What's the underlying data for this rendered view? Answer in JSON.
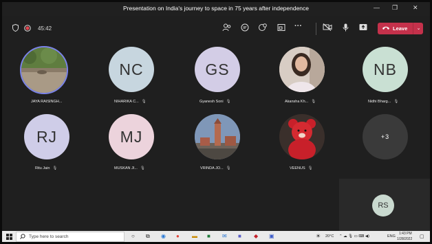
{
  "window": {
    "title": "Presentation on India's journey to space in 75 years after independence",
    "minimize_glyph": "—",
    "maximize_glyph": "❐",
    "close_glyph": "✕"
  },
  "toolbar": {
    "timer": "45:42",
    "leave_label": "Leave",
    "icons": [
      "shield-icon",
      "record-icon",
      "people-icon",
      "chat-icon",
      "reactions-icon",
      "rooms-icon",
      "more-icon",
      "camera-off-icon",
      "mic-icon",
      "share-icon",
      "phone-icon"
    ]
  },
  "participants": [
    {
      "name": "JAYA RAISINGH...",
      "initials": "",
      "type": "photo-wall",
      "speaking": true
    },
    {
      "name": "NIHARIKA C...",
      "initials": "NC",
      "color": "#c7d6df"
    },
    {
      "name": "Gyanesh Soni",
      "initials": "GS",
      "color": "#d3cde6"
    },
    {
      "name": "Akansha Kh...",
      "initials": "",
      "type": "photo-person"
    },
    {
      "name": "Nidhi Bharg...",
      "initials": "NB",
      "color": "#c9e0d3"
    },
    {
      "name": "Ritu Jain",
      "initials": "RJ",
      "color": "#cfcde8"
    },
    {
      "name": "MUSKAN JI...",
      "initials": "MJ",
      "color": "#ecd3dc"
    },
    {
      "name": "VRINDA JO...",
      "initials": "",
      "type": "photo-tower"
    },
    {
      "name": "VEENUS",
      "initials": "",
      "type": "photo-teddy"
    },
    {
      "name": "",
      "initials": "+3",
      "color": "#3a3a3a",
      "overflow": true
    }
  ],
  "self_view": {
    "initials": "RS"
  },
  "taskbar": {
    "search_placeholder": "Type here to search",
    "temperature": "20°C",
    "language": "ENG",
    "time": "1:43 PM",
    "date": "1/28/2022"
  },
  "colors": {
    "leave": "#c4314b",
    "speaking_ring": "#7b83eb",
    "background": "#1f1f1f"
  }
}
